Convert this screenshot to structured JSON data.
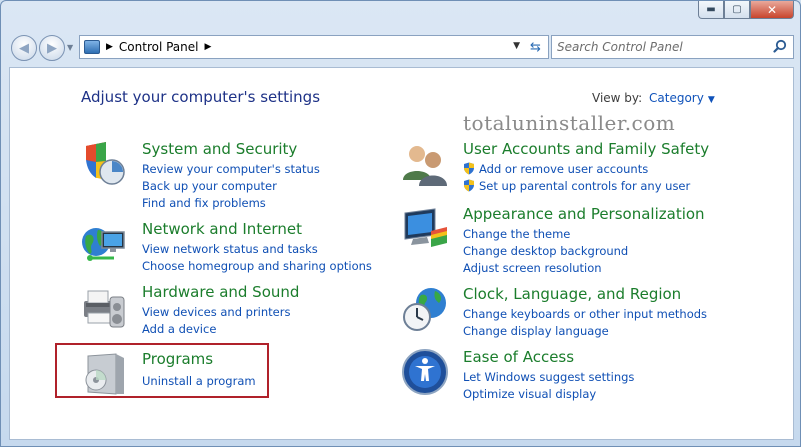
{
  "window": {
    "caption_minimize": "▬",
    "caption_maximize": "▢",
    "caption_close": "✕"
  },
  "address_bar": {
    "path_label": "Control Panel",
    "separator": "▶",
    "search_placeholder": "Search Control Panel"
  },
  "page": {
    "heading": "Adjust your computer's settings",
    "view_by_label": "View by:",
    "view_by_value": "Category",
    "watermark": "totaluninstaller.com"
  },
  "categories": {
    "system": {
      "title": "System and Security",
      "links": [
        "Review your computer's status",
        "Back up your computer",
        "Find and fix problems"
      ]
    },
    "network": {
      "title": "Network and Internet",
      "links": [
        "View network status and tasks",
        "Choose homegroup and sharing options"
      ]
    },
    "hardware": {
      "title": "Hardware and Sound",
      "links": [
        "View devices and printers",
        "Add a device"
      ]
    },
    "programs": {
      "title": "Programs",
      "links": [
        "Uninstall a program"
      ]
    },
    "accounts": {
      "title": "User Accounts and Family Safety",
      "links": [
        "Add or remove user accounts",
        "Set up parental controls for any user"
      ]
    },
    "appearance": {
      "title": "Appearance and Personalization",
      "links": [
        "Change the theme",
        "Change desktop background",
        "Adjust screen resolution"
      ]
    },
    "clock": {
      "title": "Clock, Language, and Region",
      "links": [
        "Change keyboards or other input methods",
        "Change display language"
      ]
    },
    "ease": {
      "title": "Ease of Access",
      "links": [
        "Let Windows suggest settings",
        "Optimize visual display"
      ]
    }
  },
  "colors": {
    "category_title": "#1b7d2c",
    "link": "#0f4fb4",
    "heading": "#1e3287",
    "highlight_box": "#b0212a"
  }
}
